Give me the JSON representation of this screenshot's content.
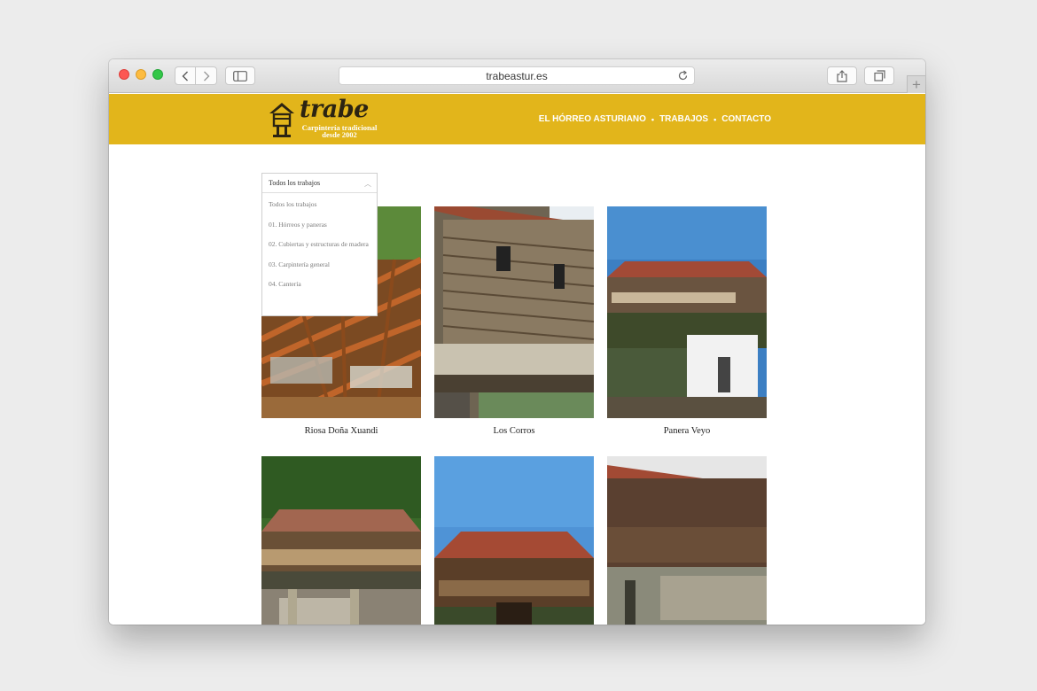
{
  "browser": {
    "url": "trabeastur.es",
    "icons": [
      "back-icon",
      "forward-icon",
      "sidebar-icon",
      "reload-icon",
      "share-icon",
      "tabs-icon",
      "plus-icon"
    ]
  },
  "site": {
    "logo": {
      "name": "trabe",
      "tagline_1": "Carpintería tradicional",
      "tagline_2": "desde 2002"
    },
    "nav": [
      "EL HÓRREO ASTURIANO",
      "TRABAJOS",
      "CONTACTO"
    ],
    "colors": {
      "header": "#e2b51b",
      "text": "#222222"
    }
  },
  "filter": {
    "selected": "Todos los trabajos",
    "options": [
      "Todos los trabajos",
      "01. Hórreos y paneras",
      "02. Cubiertas y estructuras de madera",
      "03. Carpintería general",
      "04. Cantería"
    ]
  },
  "works": [
    {
      "title": "Riosa Doña Xuandi"
    },
    {
      "title": "Los Corros"
    },
    {
      "title": "Panera Veyo"
    },
    {
      "title": ""
    },
    {
      "title": ""
    },
    {
      "title": ""
    }
  ]
}
